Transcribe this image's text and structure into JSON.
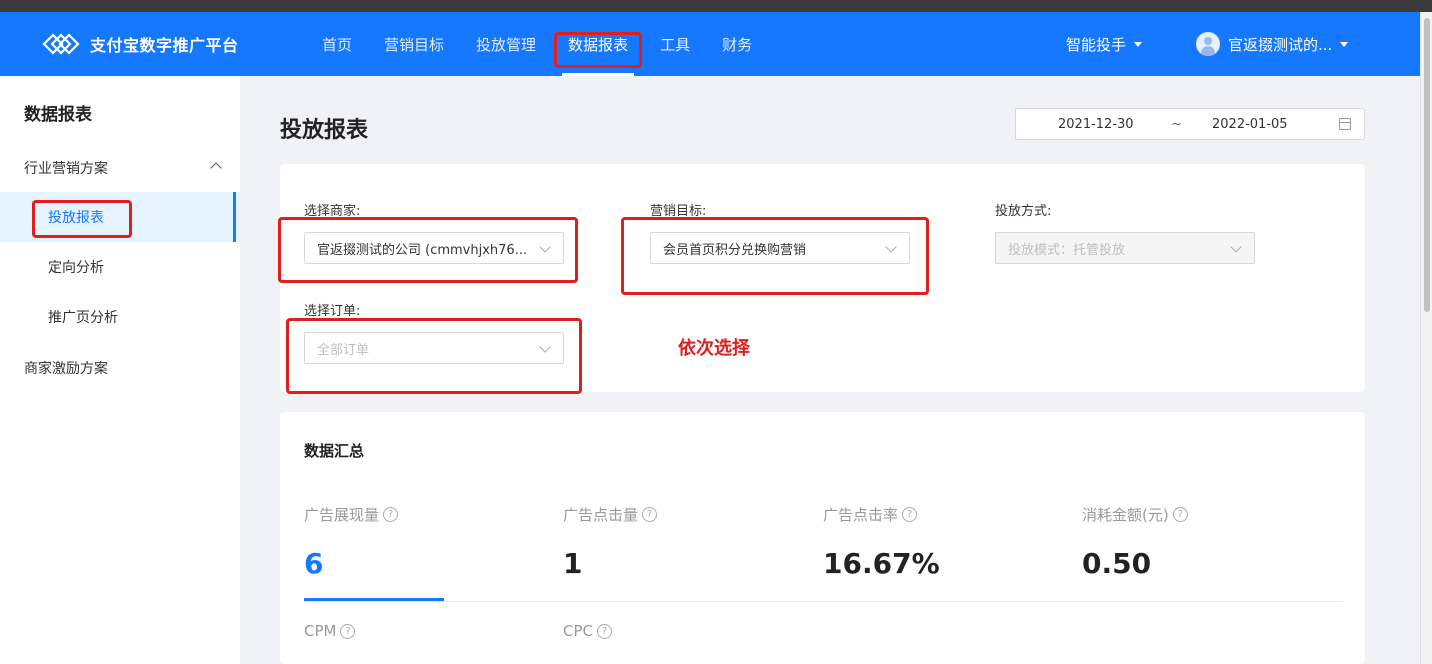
{
  "header": {
    "logo_text": "支付宝数字推广平台",
    "nav": [
      "首页",
      "营销目标",
      "投放管理",
      "数据报表",
      "工具",
      "财务"
    ],
    "active_nav": "数据报表",
    "assistant_label": "智能投手",
    "user_name": "官返掇测试的..."
  },
  "sidebar": {
    "title": "数据报表",
    "group_label": "行业营销方案",
    "items": [
      "投放报表",
      "定向分析",
      "推广页分析"
    ],
    "other_label": "商家激励方案"
  },
  "page": {
    "title": "投放报表",
    "date_start": "2021-12-30",
    "date_separator": "~",
    "date_end": "2022-01-05"
  },
  "filters": {
    "merchant_label": "选择商家:",
    "merchant_value": "官返掇测试的公司 (cmmvhjxh76...",
    "goal_label": "营销目标:",
    "goal_value": "会员首页积分兑换购营销",
    "method_label": "投放方式:",
    "method_placeholder": "投放模式：托管投放",
    "order_label": "选择订单:",
    "order_placeholder": "全部订单",
    "annotation": "依次选择"
  },
  "summary": {
    "title": "数据汇总",
    "metrics": [
      {
        "label": "广告展现量",
        "value": "6"
      },
      {
        "label": "广告点击量",
        "value": "1"
      },
      {
        "label": "广告点击率",
        "value": "16.67%"
      },
      {
        "label": "消耗金额(元)",
        "value": "0.50"
      },
      {
        "label": "CPM",
        "value": ""
      },
      {
        "label": "CPC",
        "value": ""
      }
    ]
  },
  "colors": {
    "brand": "#1677ff",
    "highlight": "#e01e1e"
  }
}
